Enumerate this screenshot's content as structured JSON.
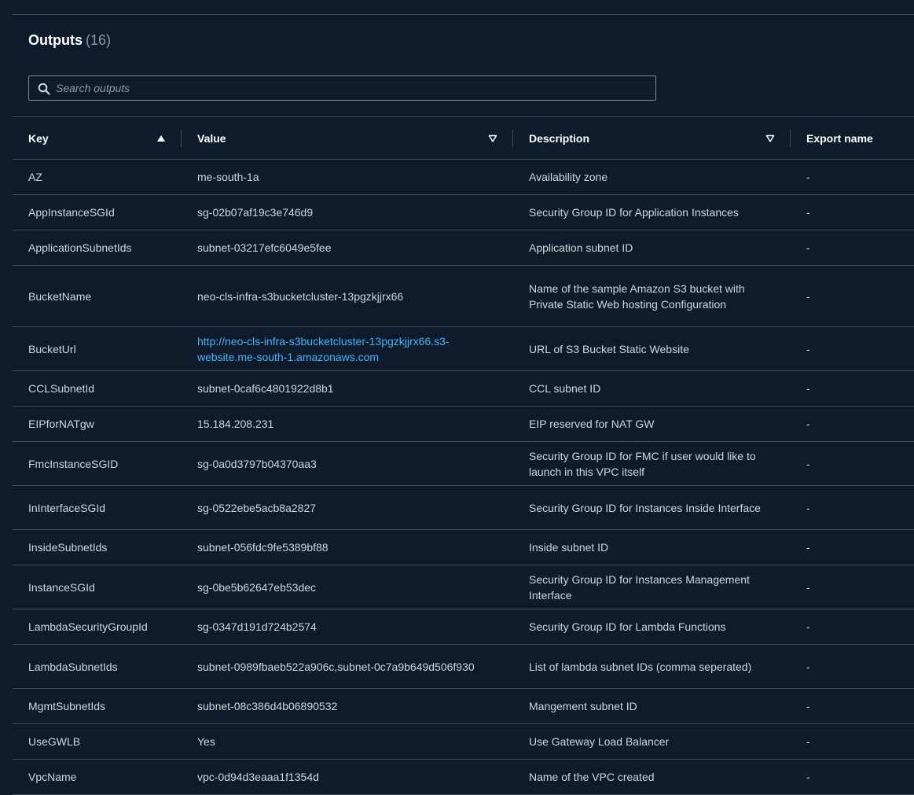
{
  "panel": {
    "title": "Outputs",
    "count": "(16)"
  },
  "search": {
    "placeholder": "Search outputs",
    "icon": "search-icon"
  },
  "table": {
    "columns": [
      {
        "label": "Key",
        "sort": "ascending"
      },
      {
        "label": "Value",
        "sort": "descending-inactive"
      },
      {
        "label": "Description",
        "sort": "descending-inactive"
      },
      {
        "label": "Export name",
        "sort": "none"
      }
    ],
    "rows": [
      {
        "key": "AZ",
        "value": "me-south-1a",
        "description": "Availability zone",
        "export": "-"
      },
      {
        "key": "AppInstanceSGId",
        "value": "sg-02b07af19c3e746d9",
        "description": "Security Group ID for Application Instances",
        "export": "-"
      },
      {
        "key": "ApplicationSubnetIds",
        "value": "subnet-03217efc6049e5fee",
        "description": "Application subnet ID",
        "export": "-"
      },
      {
        "key": "BucketName",
        "value": "neo-cls-infra-s3bucketcluster-13pgzkjjrx66",
        "description": "Name of the sample Amazon S3 bucket with Private Static Web hosting Configuration",
        "export": "-"
      },
      {
        "key": "BucketUrl",
        "value": "http://neo-cls-infra-s3bucketcluster-13pgzkjjrx66.s3-website.me-south-1.amazonaws.com",
        "description": "URL of S3 Bucket Static Website",
        "export": "-"
      },
      {
        "key": "CCLSubnetId",
        "value": "subnet-0caf6c4801922d8b1",
        "description": "CCL subnet ID",
        "export": "-"
      },
      {
        "key": "EIPforNATgw",
        "value": "15.184.208.231",
        "description": "EIP reserved for NAT GW",
        "export": "-"
      },
      {
        "key": "FmcInstanceSGID",
        "value": "sg-0a0d3797b04370aa3",
        "description": "Security Group ID for FMC if user would like to launch in this VPC itself",
        "export": "-"
      },
      {
        "key": "InInterfaceSGId",
        "value": "sg-0522ebe5acb8a2827",
        "description": "Security Group ID for Instances Inside Interface",
        "export": "-"
      },
      {
        "key": "InsideSubnetIds",
        "value": "subnet-056fdc9fe5389bf88",
        "description": "Inside subnet ID",
        "export": "-"
      },
      {
        "key": "InstanceSGId",
        "value": "sg-0be5b62647eb53dec",
        "description": "Security Group ID for Instances Management Interface",
        "export": "-"
      },
      {
        "key": "LambdaSecurityGroupId",
        "value": "sg-0347d191d724b2574",
        "description": "Security Group ID for Lambda Functions",
        "export": "-"
      },
      {
        "key": "LambdaSubnetIds",
        "value": "subnet-0989fbaeb522a906c,subnet-0c7a9b649d506f930",
        "description": "List of lambda subnet IDs (comma seperated)",
        "export": "-"
      },
      {
        "key": "MgmtSubnetIds",
        "value": "subnet-08c386d4b06890532",
        "description": "Mangement subnet ID",
        "export": "-"
      },
      {
        "key": "UseGWLB",
        "value": "Yes",
        "description": "Use Gateway Load Balancer",
        "export": "-"
      },
      {
        "key": "VpcName",
        "value": "vpc-0d94d3eaaa1f1354d",
        "description": "Name of the VPC created",
        "export": "-"
      }
    ]
  },
  "colors": {
    "background": "#0f1b2a",
    "text": "#d1d5db",
    "heading": "#ffffff",
    "link": "#42b4ff",
    "border": "#414d5c",
    "muted": "#8d99a8"
  }
}
